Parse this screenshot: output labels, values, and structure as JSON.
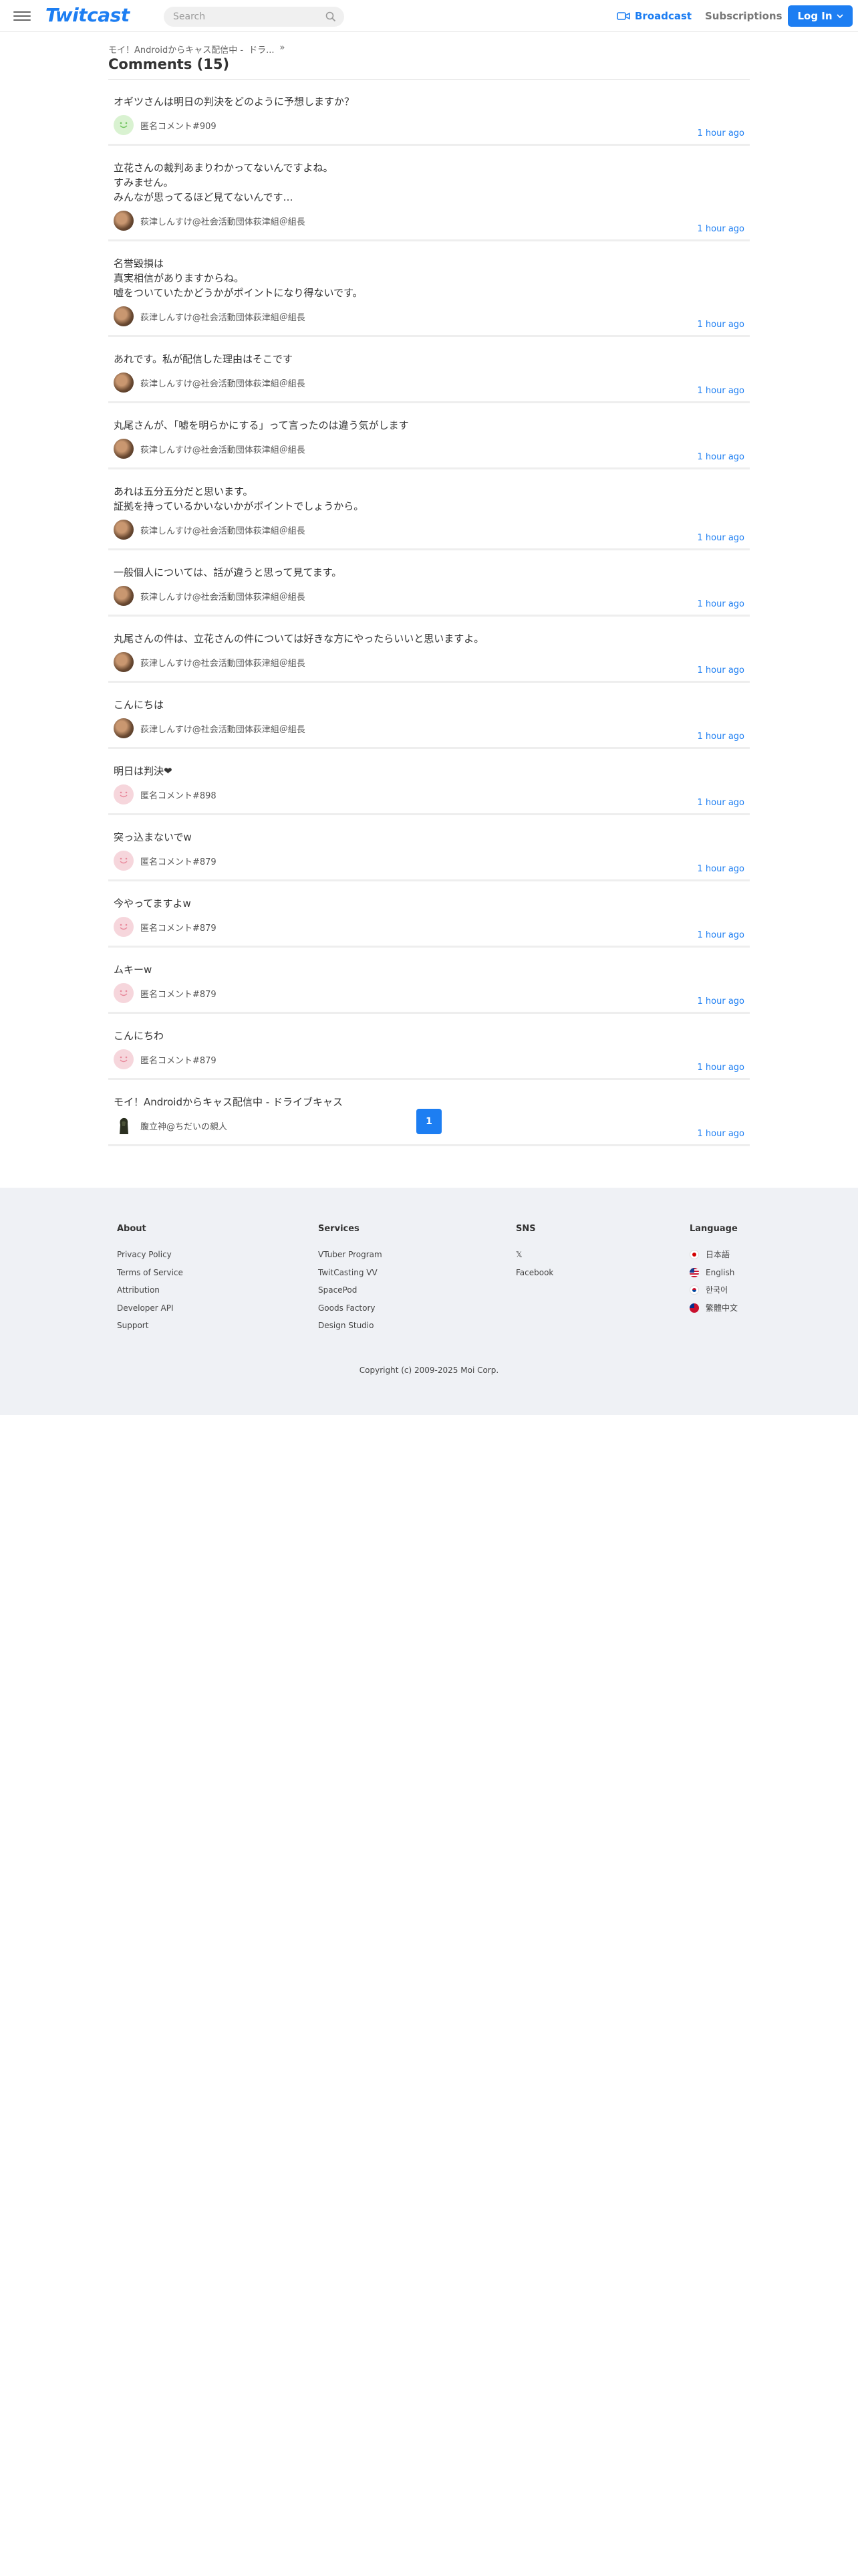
{
  "header": {
    "logo": "Twitcast",
    "search_placeholder": "Search",
    "broadcast_label": "Broadcast",
    "subscriptions_label": "Subscriptions",
    "login_label": "Log In"
  },
  "breadcrumb": {
    "item1": "モイ！Androidからキャス配信中 -",
    "item2": "ドラ...",
    "separator": "»"
  },
  "page_title": "Comments (15)",
  "comments": [
    {
      "text": "オギツさんは明日の判決をどのように予想しますか？",
      "user": "匿名コメント#909",
      "time": "1 hour ago",
      "avatar": "anon-green"
    },
    {
      "text": "立花さんの裁判あまりわかってないんですよね。\nすみません。\nみんなが思ってるほど見てないんです…",
      "user": "荻津しんすけ@社会活動団体荻津組＠組長",
      "time": "1 hour ago",
      "avatar": "photo"
    },
    {
      "text": "名誉毀損は\n真実相信がありますからね。\n嘘をついていたかどうかがポイントになり得ないです。",
      "user": "荻津しんすけ@社会活動団体荻津組＠組長",
      "time": "1 hour ago",
      "avatar": "photo"
    },
    {
      "text": "あれです。私が配信した理由はそこです",
      "user": "荻津しんすけ@社会活動団体荻津組＠組長",
      "time": "1 hour ago",
      "avatar": "photo"
    },
    {
      "text": "丸尾さんが、「嘘を明らかにする」って言ったのは違う気がします",
      "user": "荻津しんすけ@社会活動団体荻津組＠組長",
      "time": "1 hour ago",
      "avatar": "photo"
    },
    {
      "text": "あれは五分五分だと思います。\n証拠を持っているかいないかがポイントでしょうから。",
      "user": "荻津しんすけ@社会活動団体荻津組＠組長",
      "time": "1 hour ago",
      "avatar": "photo"
    },
    {
      "text": "一般個人については、話が違うと思って見てます。",
      "user": "荻津しんすけ@社会活動団体荻津組＠組長",
      "time": "1 hour ago",
      "avatar": "photo"
    },
    {
      "text": "丸尾さんの件は、立花さんの件については好きな方にやったらいいと思いますよ。",
      "user": "荻津しんすけ@社会活動団体荻津組＠組長",
      "time": "1 hour ago",
      "avatar": "photo"
    },
    {
      "text": "こんにちは",
      "user": "荻津しんすけ@社会活動団体荻津組＠組長",
      "time": "1 hour ago",
      "avatar": "photo"
    },
    {
      "text": "明日は判決❤",
      "user": "匿名コメント#898",
      "time": "1 hour ago",
      "avatar": "anon"
    },
    {
      "text": "突っ込まないでw",
      "user": "匿名コメント#879",
      "time": "1 hour ago",
      "avatar": "anon"
    },
    {
      "text": "今やってますよw",
      "user": "匿名コメント#879",
      "time": "1 hour ago",
      "avatar": "anon"
    },
    {
      "text": "ムキーw",
      "user": "匿名コメント#879",
      "time": "1 hour ago",
      "avatar": "anon"
    },
    {
      "text": "こんにちわ",
      "user": "匿名コメント#879",
      "time": "1 hour ago",
      "avatar": "anon"
    },
    {
      "text": "モイ！Androidからキャス配信中 -  ドライブキャス",
      "user": "腹立神@ちだいの親人",
      "time": "1 hour ago",
      "avatar": "dark"
    }
  ],
  "pagination": {
    "current": "1"
  },
  "footer": {
    "about": {
      "title": "About",
      "links": [
        "Privacy Policy",
        "Terms of Service",
        "Attribution",
        "Developer API",
        "Support"
      ]
    },
    "services": {
      "title": "Services",
      "links": [
        "VTuber Program",
        "TwitCasting VV",
        "SpacePod",
        "Goods Factory",
        "Design Studio"
      ]
    },
    "sns": {
      "title": "SNS",
      "links": [
        "𝕏",
        "Facebook"
      ]
    },
    "language": {
      "title": "Language",
      "items": [
        "日本語",
        "English",
        "한국어",
        "繁體中文"
      ]
    },
    "copyright": "Copyright (c) 2009-2025 Moi Corp."
  },
  "colors": {
    "accent": "#1d7ef2",
    "footer_bg": "#eff1f5"
  }
}
